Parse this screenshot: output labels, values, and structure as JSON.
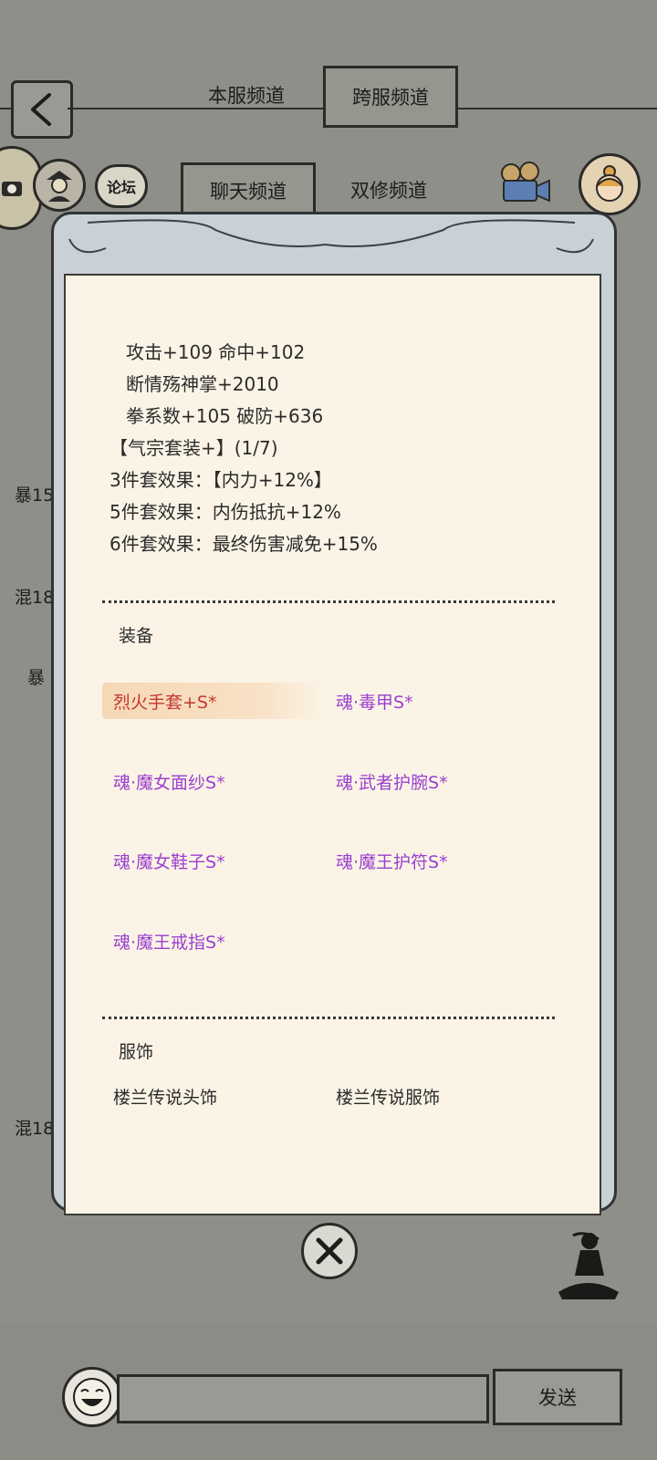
{
  "header": {
    "tabs_top": [
      {
        "label": "本服频道"
      },
      {
        "label": "跨服频道"
      }
    ],
    "tabs_second": [
      {
        "label": "聊天频道"
      },
      {
        "label": "双修频道"
      }
    ],
    "forum_label": "论坛"
  },
  "background_chat": {
    "fragments": [
      "暴15",
      "混18",
      "暴",
      "混18"
    ]
  },
  "modal": {
    "stats": [
      "攻击+109 命中+102",
      "断情殇神掌+2010",
      "拳系数+105 破防+636",
      "【气宗套装+】(1/7)",
      "3件套效果：【内力+12%】",
      "5件套效果：内伤抵抗+12%",
      "6件套效果：最终伤害减免+15%"
    ],
    "equipment_title": "装备",
    "equipment": [
      "烈火手套+S*",
      "魂·毒甲S*",
      "魂·魔女面纱S*",
      "魂·武者护腕S*",
      "魂·魔女鞋子S*",
      "魂·魔王护符S*",
      "魂·魔王戒指S*"
    ],
    "costume_title": "服饰",
    "costumes": [
      "楼兰传说头饰",
      "楼兰传说服饰"
    ]
  },
  "footer": {
    "send_label": "发送",
    "input_placeholder": ""
  },
  "colors": {
    "soul_item": "#9a3fd1",
    "selected_item": "#c4372d",
    "paper": "#fbf4e6"
  }
}
